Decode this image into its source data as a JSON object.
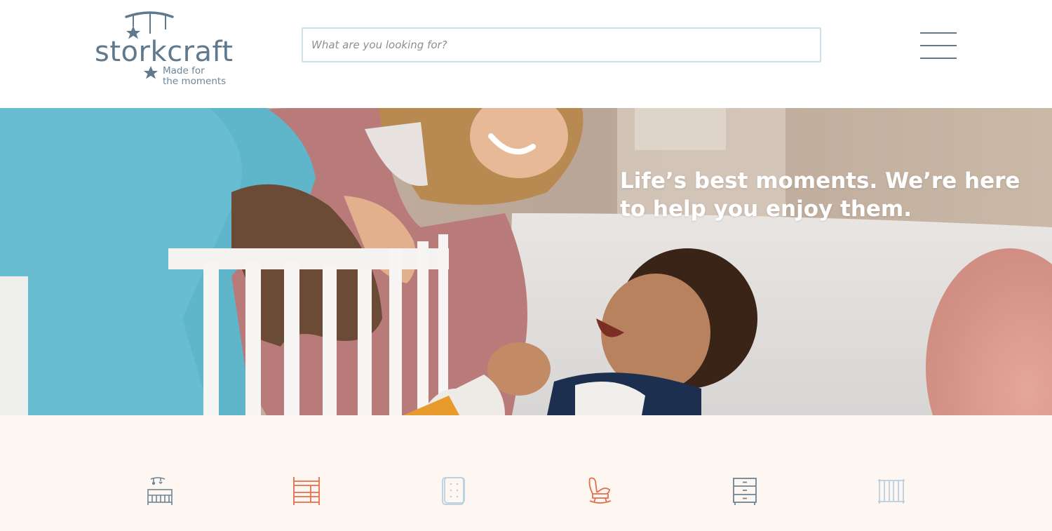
{
  "brand": {
    "name": "storkcraft",
    "tagline_line1": "Made for",
    "tagline_line2": "the moments",
    "color": "#5f7a8e"
  },
  "search": {
    "placeholder": "What are you looking for?",
    "value": ""
  },
  "menu": {
    "icon": "hamburger-menu-icon"
  },
  "hero": {
    "headline": "Life’s best moments. We’re here to help you enjoy them."
  },
  "categories": [
    {
      "icon": "crib-with-mobile-icon",
      "color": "#6c8597"
    },
    {
      "icon": "bunk-bed-icon",
      "color": "#e36e4c"
    },
    {
      "icon": "mattress-icon",
      "color": "#b9cfe0"
    },
    {
      "icon": "glider-chair-icon",
      "color": "#e36e4c"
    },
    {
      "icon": "dresser-icon",
      "color": "#6c8597"
    },
    {
      "icon": "crib-rail-icon",
      "color": "#b9cfe0"
    }
  ],
  "colors": {
    "brand_slate": "#5f7a8e",
    "accent_coral": "#e36e4c",
    "light_blue": "#b9cfe0",
    "cream": "#fef7f1"
  }
}
